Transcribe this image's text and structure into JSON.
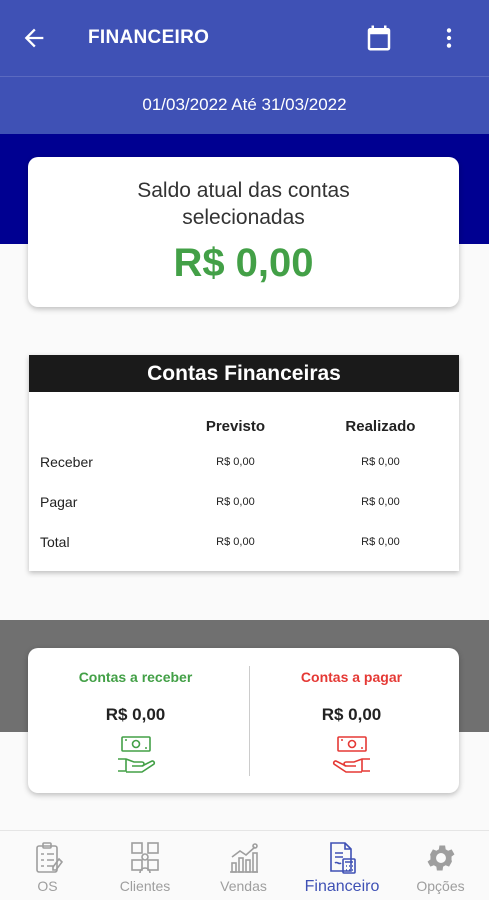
{
  "header": {
    "title": "FINANCEIRO"
  },
  "period": {
    "label": "01/03/2022 Até 31/03/2022"
  },
  "balance": {
    "label": "Saldo atual das contas selecionadas",
    "value": "R$ 0,00"
  },
  "accounts": {
    "title": "Contas Financeiras",
    "columns": [
      "",
      "Previsto",
      "Realizado"
    ],
    "rows": [
      {
        "label": "Receber",
        "previsto": "R$ 0,00",
        "realizado": "R$ 0,00"
      },
      {
        "label": "Pagar",
        "previsto": "R$ 0,00",
        "realizado": "R$ 0,00"
      },
      {
        "label": "Total",
        "previsto": "R$ 0,00",
        "realizado": "R$ 0,00"
      }
    ]
  },
  "summary": {
    "receivable": {
      "title": "Contas a receber",
      "value": "R$ 0,00"
    },
    "payable": {
      "title": "Contas a pagar",
      "value": "R$ 0,00"
    }
  },
  "nav": {
    "items": [
      {
        "label": "OS"
      },
      {
        "label": "Clientes"
      },
      {
        "label": "Vendas"
      },
      {
        "label": "Financeiro"
      },
      {
        "label": "Opções"
      }
    ]
  },
  "colors": {
    "primary": "#3f51b5",
    "navy": "#000091",
    "positive": "#43a047",
    "negative": "#e53935",
    "inactive": "#9e9e9e"
  }
}
